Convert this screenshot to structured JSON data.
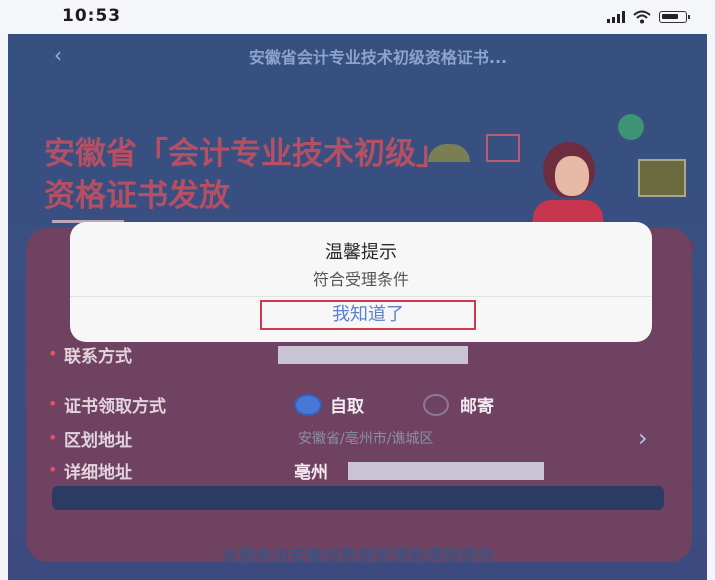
{
  "status_bar": {
    "time": "10:53"
  },
  "nav": {
    "title": "安徽省会计专业技术初级资格证书..."
  },
  "hero": {
    "line1": "安徽省「会计专业技术初级」",
    "line2": "资格证书发放"
  },
  "form": {
    "contact_label": "联系方式",
    "pickup_label": "证书领取方式",
    "pickup_options": [
      "自取",
      "邮寄"
    ],
    "district_label": "区划地址",
    "district_placeholder": "安徽省/亳州市/谯城区",
    "address_label": "详细地址",
    "address_prefix": "亳州"
  },
  "footer": {
    "note": "本服务由安徽省数据资源管理局提供"
  },
  "modal": {
    "title": "温馨提示",
    "message": "符合受理条件",
    "confirm_label": "我知道了"
  },
  "colors": {
    "background": "#3a4f82",
    "accent": "#b54f64",
    "confirm_text": "#5c7fd1",
    "highlight_border": "#d23a4b"
  }
}
